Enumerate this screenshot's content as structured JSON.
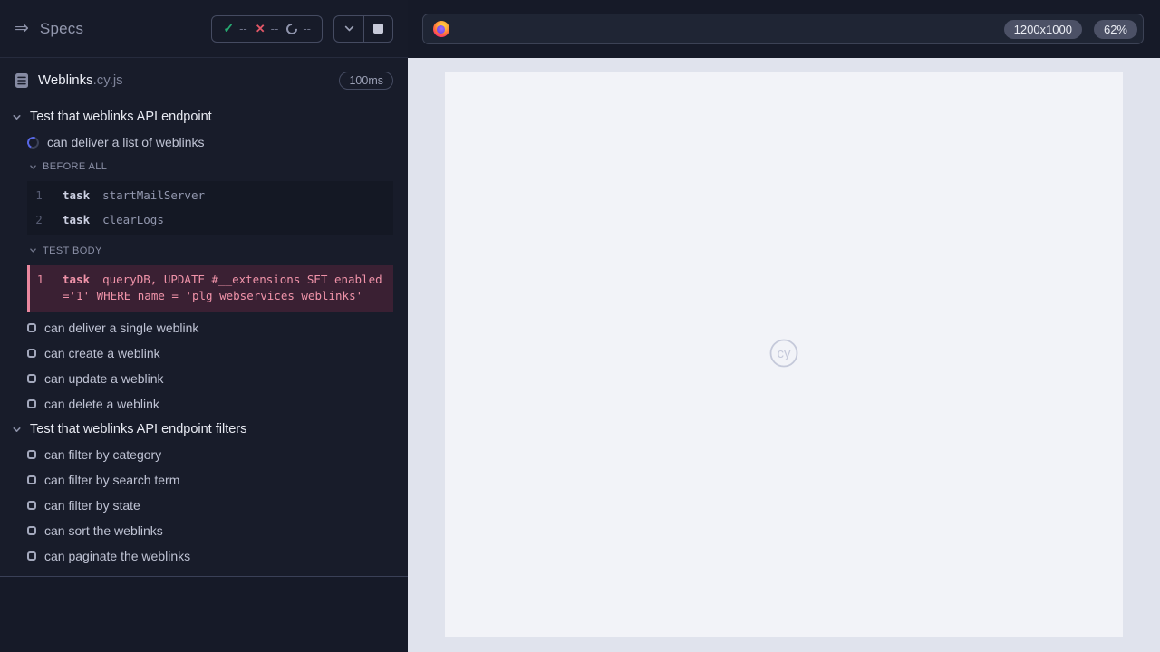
{
  "colors": {
    "sidebar_bg": "#181c2a",
    "passed_green": "#26a971",
    "failed_red": "#e25767",
    "running_blue": "#5767e6",
    "error_pink": "#f093a9",
    "error_bg": "#3a2033",
    "preview_bg": "#e0e3ed",
    "frame_bg": "#f2f3f8",
    "watermark_gray": "#c5c9da"
  },
  "sidebar": {
    "title": "Specs",
    "toggle_icon": "⇒",
    "stats": {
      "passed": {
        "icon": "✓",
        "count": "--"
      },
      "failed": {
        "icon": "✕",
        "count": "--"
      },
      "pending": {
        "icon": "circle",
        "count": "--"
      }
    },
    "spec": {
      "name": "Weblinks",
      "extension": ".cy.js",
      "duration": "100ms"
    },
    "tree": [
      {
        "type": "suite",
        "label": "Test that weblinks API endpoint"
      },
      {
        "type": "test",
        "state": "running",
        "label": "can deliver a list of weblinks"
      },
      {
        "type": "hook",
        "label": "BEFORE ALL",
        "commands": [
          {
            "number": "1",
            "method": "task",
            "message": "startMailServer"
          },
          {
            "number": "2",
            "method": "task",
            "message": "clearLogs"
          }
        ]
      },
      {
        "type": "hook",
        "label": "TEST BODY",
        "commands": [
          {
            "number": "1",
            "method": "task",
            "message": "queryDB, UPDATE #__extensions SET enabled='1' WHERE name = 'plg_webservices_weblinks'",
            "state": "failed"
          }
        ]
      },
      {
        "type": "test",
        "state": "pending",
        "label": "can deliver a single weblink"
      },
      {
        "type": "test",
        "state": "pending",
        "label": "can create a weblink"
      },
      {
        "type": "test",
        "state": "pending",
        "label": "can update a weblink"
      },
      {
        "type": "test",
        "state": "pending",
        "label": "can delete a weblink"
      },
      {
        "type": "suite",
        "label": "Test that weblinks API endpoint filters"
      },
      {
        "type": "test",
        "state": "pending",
        "label": "can filter by category"
      },
      {
        "type": "test",
        "state": "pending",
        "label": "can filter by search term"
      },
      {
        "type": "test",
        "state": "pending",
        "label": "can filter by state"
      },
      {
        "type": "test",
        "state": "pending",
        "label": "can sort the weblinks"
      },
      {
        "type": "test",
        "state": "pending",
        "label": "can paginate the weblinks"
      }
    ]
  },
  "preview": {
    "url_bar": {
      "browser_icon": "firefox",
      "viewport_size": "1200x1000",
      "zoom_level": "62%"
    },
    "watermark": "cy"
  }
}
